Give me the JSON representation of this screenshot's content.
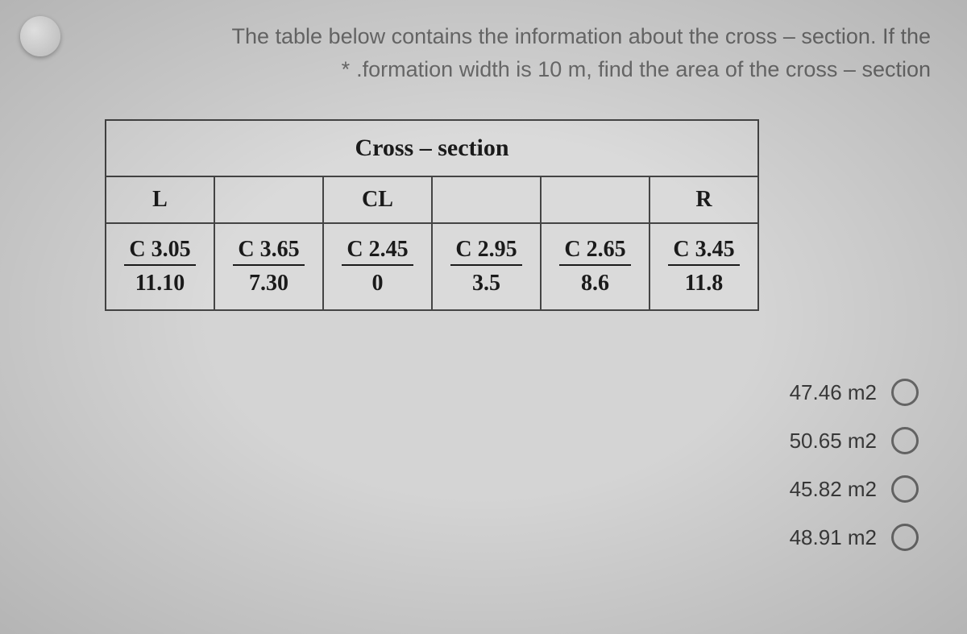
{
  "question": {
    "line1": "The table below contains the information about the cross – section. If the",
    "line2": ".formation width is 10 m, find the area of the cross – section",
    "asterisk": "*"
  },
  "table": {
    "title": "Cross – section",
    "headers": [
      "L",
      "",
      "CL",
      "",
      "",
      "R"
    ],
    "cells": [
      {
        "top": "C 3.05",
        "bottom": "11.10"
      },
      {
        "top": "C 3.65",
        "bottom": "7.30"
      },
      {
        "top": "C 2.45",
        "bottom": "0"
      },
      {
        "top": "C 2.95",
        "bottom": "3.5"
      },
      {
        "top": "C 2.65",
        "bottom": "8.6"
      },
      {
        "top": "C 3.45",
        "bottom": "11.8"
      }
    ]
  },
  "options": [
    {
      "label": "47.46 m2"
    },
    {
      "label": "50.65 m2"
    },
    {
      "label": "45.82 m2"
    },
    {
      "label": "48.91 m2"
    }
  ]
}
